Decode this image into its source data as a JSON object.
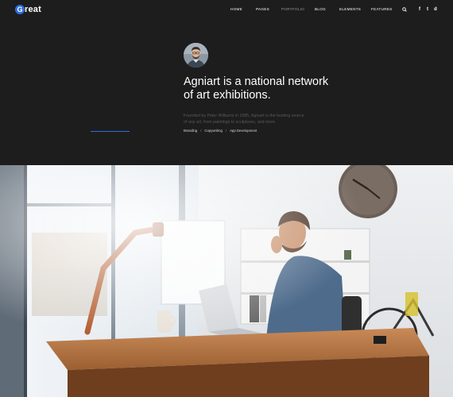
{
  "brand": {
    "logo_letter": "G",
    "logo_rest": "reat",
    "accent_color": "#2f6dde"
  },
  "nav": {
    "items": [
      {
        "label": "Home"
      },
      {
        "label": "Pages"
      },
      {
        "label": "Portfolio"
      },
      {
        "label": "Blog"
      },
      {
        "label": "Elements"
      },
      {
        "label": "Features"
      }
    ],
    "icons": [
      "search-icon",
      "facebook-icon",
      "twitter-icon",
      "dribbble-icon"
    ],
    "social": {
      "facebook": "f",
      "twitter": "t",
      "dribbble": "d"
    }
  },
  "hero": {
    "headline_line1": "Agniart is a national network",
    "headline_line2": "of art exhibitions.",
    "description_line1": "Founded by Peter Williams in 1985, Agniart is the leading source",
    "description_line2": "of any art, from paintings to sculptures, and more.",
    "tags": [
      "Branding",
      "Copywriting",
      "App Development"
    ],
    "tag_separator": "/",
    "background_color": "#1d1d1d"
  }
}
